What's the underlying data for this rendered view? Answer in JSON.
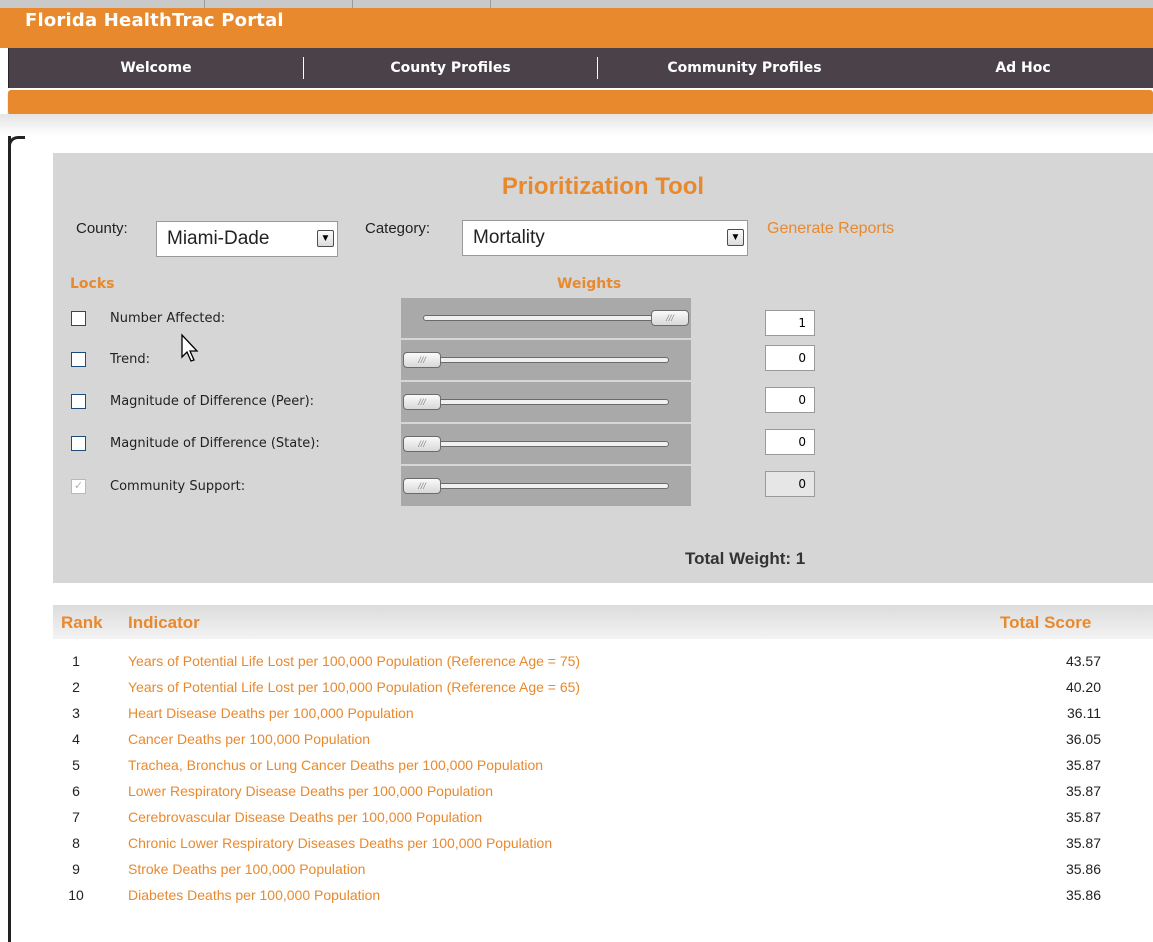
{
  "header": {
    "title": "Florida HealthTrac Portal"
  },
  "nav": [
    {
      "label": "Welcome"
    },
    {
      "label": "County Profiles"
    },
    {
      "label": "Community Profiles"
    },
    {
      "label": "Ad Hoc"
    }
  ],
  "tool": {
    "title": "Prioritization Tool",
    "county_label": "County:",
    "county_value": "Miami-Dade",
    "category_label": "Category:",
    "category_value": "Mortality",
    "generate_link": "Generate Reports",
    "locks_heading": "Locks",
    "weights_heading": "Weights",
    "rows": [
      {
        "label": "Number Affected:",
        "locked": false,
        "disabled": false,
        "weight": "1"
      },
      {
        "label": "Trend:",
        "locked": false,
        "disabled": false,
        "weight": "0"
      },
      {
        "label": "Magnitude of Difference (Peer):",
        "locked": false,
        "disabled": false,
        "weight": "0"
      },
      {
        "label": "Magnitude of Difference (State):",
        "locked": false,
        "disabled": false,
        "weight": "0"
      },
      {
        "label": "Community Support:",
        "locked": true,
        "disabled": true,
        "weight": "0"
      }
    ],
    "slider_thumb_glyph": "///",
    "total_weight": "Total Weight: 1"
  },
  "table": {
    "headers": {
      "rank": "Rank",
      "indicator": "Indicator",
      "score": "Total Score"
    },
    "rows": [
      {
        "rank": "1",
        "indicator": "Years of Potential Life Lost per 100,000 Population (Reference Age = 75)",
        "score": "43.57"
      },
      {
        "rank": "2",
        "indicator": "Years of Potential Life Lost per 100,000 Population (Reference Age = 65)",
        "score": "40.20"
      },
      {
        "rank": "3",
        "indicator": "Heart Disease Deaths per 100,000 Population",
        "score": "36.11"
      },
      {
        "rank": "4",
        "indicator": "Cancer Deaths per 100,000 Population",
        "score": "36.05"
      },
      {
        "rank": "5",
        "indicator": "Trachea, Bronchus or Lung Cancer Deaths per 100,000 Population",
        "score": "35.87"
      },
      {
        "rank": "6",
        "indicator": "Lower Respiratory Disease Deaths per 100,000 Population",
        "score": "35.87"
      },
      {
        "rank": "7",
        "indicator": "Cerebrovascular Disease Deaths per 100,000 Population",
        "score": "35.87"
      },
      {
        "rank": "8",
        "indicator": "Chronic Lower Respiratory Diseases Deaths per 100,000 Population",
        "score": "35.87"
      },
      {
        "rank": "9",
        "indicator": "Stroke Deaths per 100,000 Population",
        "score": "35.86"
      },
      {
        "rank": "10",
        "indicator": "Diabetes Deaths per 100,000 Population",
        "score": "35.86"
      }
    ]
  },
  "icons": {
    "dropdown": "chevron-down-icon",
    "check": "check-icon",
    "cursor": "mouse-pointer-icon"
  },
  "colors": {
    "accent": "#e8892e",
    "nav_bg": "#4a4248",
    "panel_bg": "#d6d6d6"
  }
}
